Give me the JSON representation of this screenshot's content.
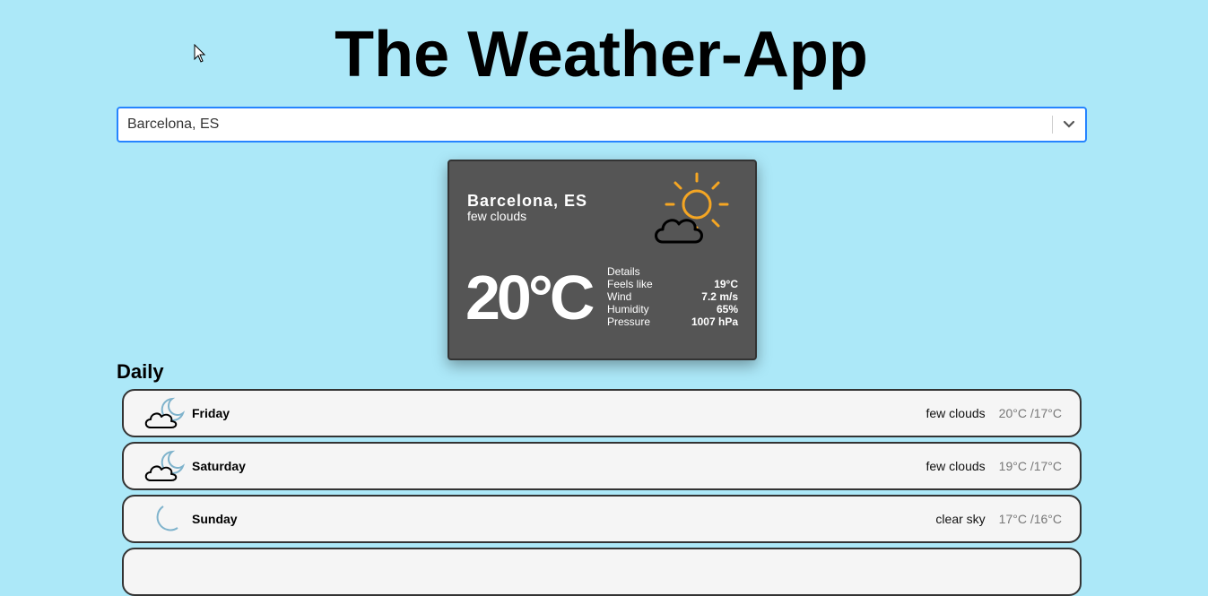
{
  "app": {
    "title": "The Weather-App"
  },
  "search": {
    "value": "Barcelona, ES"
  },
  "current": {
    "city": "Barcelona, ES",
    "description": "few clouds",
    "icon": "sun-cloud-icon",
    "temperature": "20°C",
    "details_label": "Details",
    "details": [
      {
        "label": "Feels like",
        "value": "19°C"
      },
      {
        "label": "Wind",
        "value": "7.2 m/s"
      },
      {
        "label": "Humidity",
        "value": "65%"
      },
      {
        "label": "Pressure",
        "value": "1007 hPa"
      }
    ]
  },
  "daily": {
    "title": "Daily",
    "days": [
      {
        "day": "Friday",
        "condition": "few clouds",
        "range": "20°C /17°C",
        "icon": "moon-cloud-icon"
      },
      {
        "day": "Saturday",
        "condition": "few clouds",
        "range": "19°C /17°C",
        "icon": "moon-cloud-icon"
      },
      {
        "day": "Sunday",
        "condition": "clear sky",
        "range": "17°C /16°C",
        "icon": "moon-icon"
      }
    ]
  },
  "colors": {
    "background": "#ace8f8",
    "card": "#555555",
    "sun": "#f5a623",
    "moon": "#7fb3cc",
    "select_border": "#2684ff"
  }
}
